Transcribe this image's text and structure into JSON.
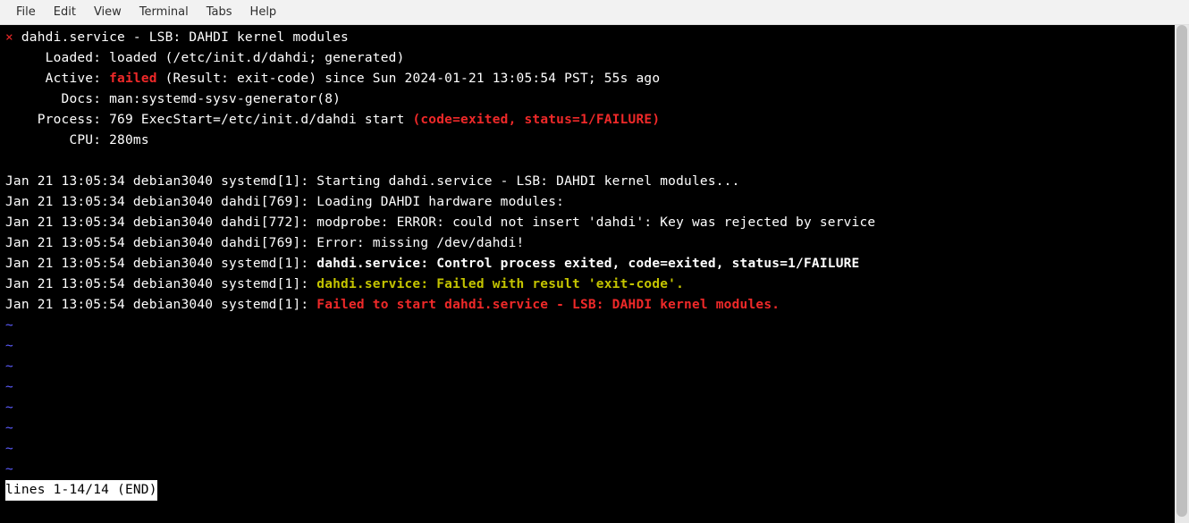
{
  "menubar": {
    "file": "File",
    "edit": "Edit",
    "view": "View",
    "terminal": "Terminal",
    "tabs": "Tabs",
    "help": "Help"
  },
  "service": {
    "x": "×",
    "title": " dahdi.service - LSB: DAHDI kernel modules",
    "loaded_label": "     Loaded: ",
    "loaded_value": "loaded (/etc/init.d/dahdi; generated)",
    "active_label": "     Active: ",
    "active_failed": "failed",
    "active_rest": " (Result: exit-code) since Sun 2024-01-21 13:05:54 PST; 55s ago",
    "docs_label": "       Docs: ",
    "docs_value": "man:systemd-sysv-generator(8)",
    "process_label": "    Process: ",
    "process_value": "769 ExecStart=/etc/init.d/dahdi start ",
    "process_fail": "(code=exited, status=1/FAILURE)",
    "cpu_label": "        CPU: ",
    "cpu_value": "280ms"
  },
  "log": {
    "l1_prefix": "Jan 21 13:05:34 debian3040 systemd[1]: ",
    "l1_text": "Starting dahdi.service - LSB: DAHDI kernel modules...",
    "l2_prefix": "Jan 21 13:05:34 debian3040 dahdi[769]: ",
    "l2_text": "Loading DAHDI hardware modules:",
    "l3_prefix": "Jan 21 13:05:34 debian3040 dahdi[772]: ",
    "l3_text": "modprobe: ERROR: could not insert 'dahdi': Key was rejected by service",
    "l4_prefix": "Jan 21 13:05:54 debian3040 dahdi[769]: ",
    "l4_text": "Error: missing /dev/dahdi!",
    "l5_prefix": "Jan 21 13:05:54 debian3040 systemd[1]: ",
    "l5_text": "dahdi.service: Control process exited, code=exited, status=1/FAILURE",
    "l6_prefix": "Jan 21 13:05:54 debian3040 systemd[1]: ",
    "l6_text": "dahdi.service: Failed with result 'exit-code'.",
    "l7_prefix": "Jan 21 13:05:54 debian3040 systemd[1]: ",
    "l7_text": "Failed to start dahdi.service - LSB: DAHDI kernel modules."
  },
  "tilde": "~",
  "status_line": "lines 1-14/14 (END)"
}
